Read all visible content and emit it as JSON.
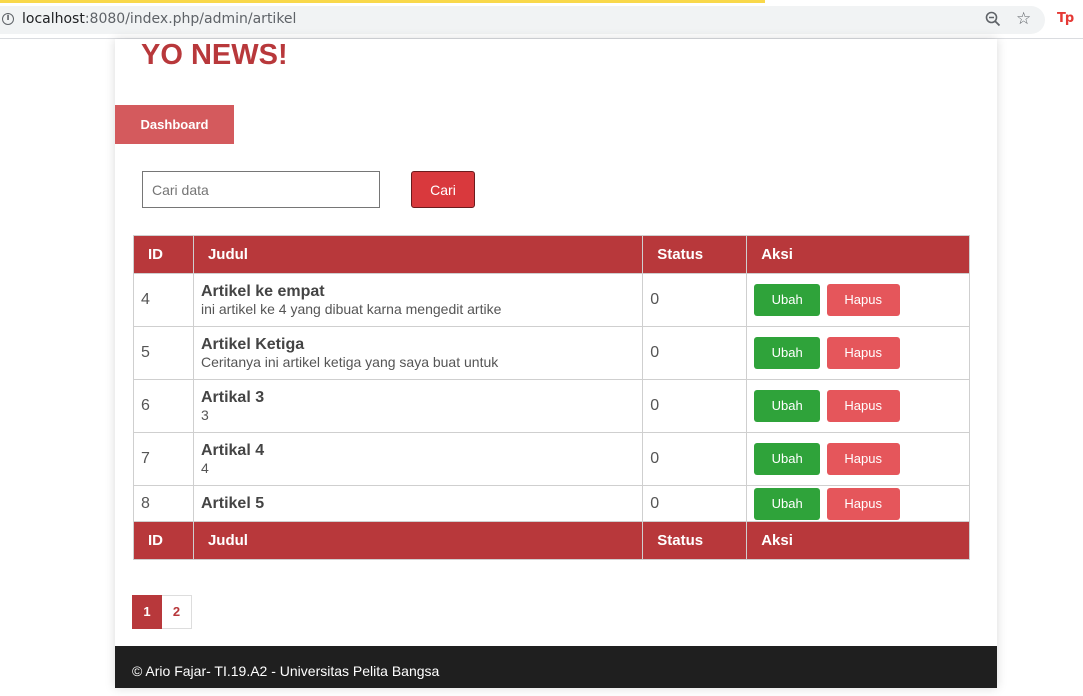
{
  "browser": {
    "url_host": "localhost",
    "url_rest": ":8080/index.php/admin/artikel",
    "info_glyph": "i",
    "star_glyph": "☆",
    "ext_label": "Tp"
  },
  "site": {
    "title": "YO NEWS!",
    "nav_dashboard": "Dashboard"
  },
  "search": {
    "placeholder": "Cari data",
    "button": "Cari"
  },
  "table": {
    "headers": [
      "ID",
      "Judul",
      "Status",
      "Aksi"
    ],
    "footers": [
      "ID",
      "Judul",
      "Status",
      "Aksi"
    ],
    "rows": [
      {
        "id": "4",
        "title": "Artikel ke empat",
        "desc": "ini artikel ke 4 yang dibuat karna mengedit artike",
        "status": "0"
      },
      {
        "id": "5",
        "title": "Artikel Ketiga",
        "desc": "Ceritanya ini artikel ketiga yang saya buat untuk",
        "status": "0"
      },
      {
        "id": "6",
        "title": "Artikal 3",
        "desc": "3",
        "status": "0"
      },
      {
        "id": "7",
        "title": "Artikal 4",
        "desc": "4",
        "status": "0"
      },
      {
        "id": "8",
        "title": "Artikel 5",
        "desc": "",
        "status": "0"
      }
    ],
    "action_edit": "Ubah",
    "action_delete": "Hapus"
  },
  "pagination": {
    "pages": [
      "1",
      "2"
    ],
    "active": "1"
  },
  "footer": {
    "text": "© Ario Fajar- TI.19.A2 - Universitas Pelita Bangsa"
  },
  "colors": {
    "brand": "#b8383b",
    "edit": "#2fa33a",
    "delete": "#e5565b"
  }
}
